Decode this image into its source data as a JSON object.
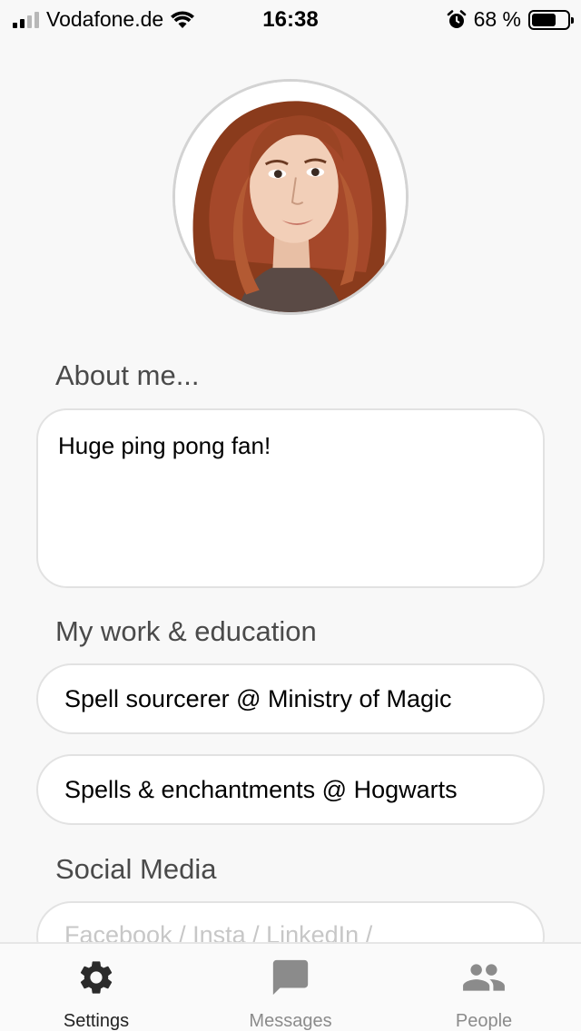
{
  "status_bar": {
    "carrier": "Vodafone.de",
    "time": "16:38",
    "battery_percent": "68 %",
    "battery_level": 0.68
  },
  "profile": {
    "about_title": "About me...",
    "about_text": "Huge ping pong fan!",
    "work_title": "My work & education",
    "work_items": [
      "Spell sourcerer @ Ministry of Magic",
      "Spells & enchantments @ Hogwarts"
    ],
    "social_title": "Social Media",
    "social_placeholder": "Facebook / Insta / LinkedIn /"
  },
  "tabs": [
    {
      "label": "Settings",
      "icon": "gear-icon",
      "active": true
    },
    {
      "label": "Messages",
      "icon": "chat-bubble-icon",
      "active": false
    },
    {
      "label": "People",
      "icon": "people-icon",
      "active": false
    }
  ],
  "colors": {
    "background": "#f8f8f8",
    "active_tab": "#222222",
    "inactive_tab": "#8b8b8b",
    "placeholder": "#c7c7c7"
  }
}
